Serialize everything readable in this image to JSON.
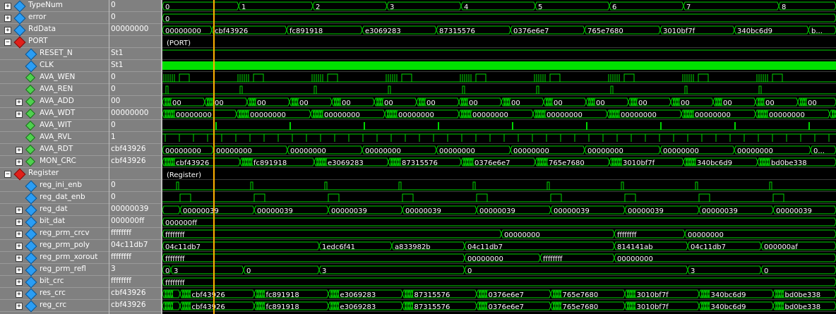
{
  "signals": [
    {
      "name": "TypeNum",
      "value": "0",
      "level": 0,
      "expand": "+",
      "icon": "blue"
    },
    {
      "name": "error",
      "value": "0",
      "level": 0,
      "expand": "+",
      "icon": "blue"
    },
    {
      "name": "RdData",
      "value": "00000000",
      "level": 0,
      "expand": "+",
      "icon": "blue"
    },
    {
      "name": "PORT",
      "value": "",
      "level": 0,
      "expand": "-",
      "icon": "red"
    },
    {
      "name": "RESET_N",
      "value": "St1",
      "level": 1,
      "expand": "",
      "icon": "blue"
    },
    {
      "name": "CLK",
      "value": "St1",
      "level": 1,
      "expand": "",
      "icon": "blue"
    },
    {
      "name": "AVA_WEN",
      "value": "0",
      "level": 1,
      "expand": "",
      "icon": "green"
    },
    {
      "name": "AVA_REN",
      "value": "0",
      "level": 1,
      "expand": "",
      "icon": "green"
    },
    {
      "name": "AVA_ADD",
      "value": "00",
      "level": 1,
      "expand": "+",
      "icon": "green"
    },
    {
      "name": "AVA_WDT",
      "value": "00000000",
      "level": 1,
      "expand": "+",
      "icon": "green"
    },
    {
      "name": "AVA_WIT",
      "value": "0",
      "level": 1,
      "expand": "",
      "icon": "green"
    },
    {
      "name": "AVA_RVL",
      "value": "1",
      "level": 1,
      "expand": "",
      "icon": "green"
    },
    {
      "name": "AVA_RDT",
      "value": "cbf43926",
      "level": 1,
      "expand": "+",
      "icon": "green"
    },
    {
      "name": "MON_CRC",
      "value": "cbf43926",
      "level": 1,
      "expand": "+",
      "icon": "green"
    },
    {
      "name": "Register",
      "value": "",
      "level": 0,
      "expand": "-",
      "icon": "red"
    },
    {
      "name": "reg_ini_enb",
      "value": "0",
      "level": 1,
      "expand": "",
      "icon": "blue"
    },
    {
      "name": "reg_dat_enb",
      "value": "0",
      "level": 1,
      "expand": "",
      "icon": "blue"
    },
    {
      "name": "reg_dat",
      "value": "00000039",
      "level": 1,
      "expand": "+",
      "icon": "blue"
    },
    {
      "name": "bit_dat",
      "value": "000000ff",
      "level": 1,
      "expand": "+",
      "icon": "blue"
    },
    {
      "name": "reg_prm_crcv",
      "value": "ffffffff",
      "level": 1,
      "expand": "+",
      "icon": "blue"
    },
    {
      "name": "reg_prm_poly",
      "value": "04c11db7",
      "level": 1,
      "expand": "+",
      "icon": "blue"
    },
    {
      "name": "reg_prm_xorout",
      "value": "ffffffff",
      "level": 1,
      "expand": "+",
      "icon": "blue"
    },
    {
      "name": "reg_prm_refl",
      "value": "3",
      "level": 1,
      "expand": "+",
      "icon": "blue"
    },
    {
      "name": "bit_crc",
      "value": "ffffffff",
      "level": 1,
      "expand": "+",
      "icon": "blue"
    },
    {
      "name": "res_crc",
      "value": "cbf43926",
      "level": 1,
      "expand": "+",
      "icon": "blue"
    },
    {
      "name": "reg_crc",
      "value": "cbf43926",
      "level": 1,
      "expand": "+",
      "icon": "blue"
    }
  ],
  "waves": {
    "typenum": [
      "0",
      "1",
      "2",
      "3",
      "4",
      "5",
      "6",
      "7",
      "8"
    ],
    "error": [
      "0"
    ],
    "rddata": [
      "00000000",
      "cbf43926",
      "fc891918",
      "e3069283",
      "87315576",
      "0376e6e7",
      "765e7680",
      "3010bf7f",
      "340bc6d9",
      "b..."
    ],
    "port_label": "(PORT)",
    "register_label": "(Register)",
    "ava_add": [
      "00",
      "00",
      "00",
      "00",
      "00",
      "00",
      "00",
      "00",
      "00",
      "00",
      "00",
      "00",
      "00",
      "00",
      "00",
      "00"
    ],
    "ava_wdt": [
      "00000000",
      "00000000",
      "00000000",
      "00000000",
      "00000000",
      "00000000",
      "00000000",
      "00000000",
      "00000000",
      "00000000"
    ],
    "ava_rdt": [
      "00000000",
      "00000000",
      "00000000",
      "00000000",
      "00000000",
      "00000000",
      "00000000",
      "00000000",
      "00000000",
      "0..."
    ],
    "mon_crc": [
      "cbf43926",
      "fc891918",
      "e3069283",
      "87315576",
      "0376e6e7",
      "765e7680",
      "3010bf7f",
      "340bc6d9",
      "bd0be338"
    ],
    "reg_dat": [
      "00000039",
      "00000039",
      "00000039",
      "00000039",
      "00000039",
      "00000039",
      "00000039",
      "00000039",
      "00000039"
    ],
    "bit_dat": [
      "000000ff"
    ],
    "reg_prm_crcv": [
      "ffffffff",
      "00000000",
      "ffffffff",
      "00000000"
    ],
    "reg_prm_poly": [
      "04c11db7",
      "1edc6f41",
      "a833982b",
      "04c11db7",
      "814141ab",
      "04c11db7",
      "000000af"
    ],
    "reg_prm_xorout": [
      "ffffffff",
      "00000000",
      "ffffffff",
      "00000000"
    ],
    "reg_prm_refl": [
      "0",
      "3",
      "0",
      "3",
      "0",
      "3",
      "0"
    ],
    "bit_crc": [
      "ffffffff"
    ],
    "res_crc": [
      "cbf43926",
      "fc891918",
      "e3069283",
      "87315576",
      "0376e6e7",
      "765e7680",
      "3010bf7f",
      "340bc6d9",
      "bd0be338"
    ],
    "reg_crc": [
      "cbf43926",
      "fc891918",
      "e3069283",
      "87315576",
      "0376e6e7",
      "765e7680",
      "3010bf7f",
      "340bc6d9",
      "bd0be338"
    ]
  },
  "colors": {
    "wave": "#00d400",
    "cursor": "#ffb000",
    "clk": "#00e000",
    "panel": "#808080",
    "background": "#000000"
  }
}
